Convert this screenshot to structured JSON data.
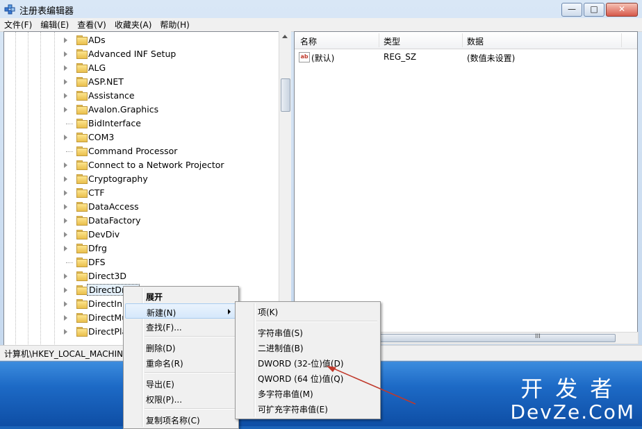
{
  "window": {
    "title": "注册表编辑器",
    "buttons": {
      "minimize": "—",
      "maximize": "□",
      "close": "✕"
    }
  },
  "menubar": [
    "文件(F)",
    "编辑(E)",
    "查看(V)",
    "收藏夹(A)",
    "帮助(H)"
  ],
  "tree": {
    "items": [
      {
        "label": "ADs",
        "expandable": true
      },
      {
        "label": "Advanced INF Setup",
        "expandable": true
      },
      {
        "label": "ALG",
        "expandable": true
      },
      {
        "label": "ASP.NET",
        "expandable": true
      },
      {
        "label": "Assistance",
        "expandable": true
      },
      {
        "label": "Avalon.Graphics",
        "expandable": true
      },
      {
        "label": "BidInterface",
        "expandable": false
      },
      {
        "label": "COM3",
        "expandable": true
      },
      {
        "label": "Command Processor",
        "expandable": false
      },
      {
        "label": "Connect to a Network Projector",
        "expandable": true
      },
      {
        "label": "Cryptography",
        "expandable": true
      },
      {
        "label": "CTF",
        "expandable": true
      },
      {
        "label": "DataAccess",
        "expandable": true
      },
      {
        "label": "DataFactory",
        "expandable": true
      },
      {
        "label": "DevDiv",
        "expandable": true
      },
      {
        "label": "Dfrg",
        "expandable": true
      },
      {
        "label": "DFS",
        "expandable": false
      },
      {
        "label": "Direct3D",
        "expandable": true
      },
      {
        "label": "DirectDraw",
        "expandable": true,
        "selected": true
      },
      {
        "label": "DirectInput",
        "expandable": true
      },
      {
        "label": "DirectMusic",
        "expandable": true
      },
      {
        "label": "DirectPlay",
        "expandable": true
      }
    ]
  },
  "list": {
    "columns": [
      "名称",
      "类型",
      "数据"
    ],
    "rows": [
      {
        "name": "(默认)",
        "type": "REG_SZ",
        "data": "(数值未设置)",
        "icon": "string-value-icon"
      }
    ]
  },
  "statusbar": {
    "path": "计算机\\HKEY_LOCAL_MACHIN"
  },
  "context_menu": {
    "items": [
      {
        "label": "展开",
        "bold": true
      },
      {
        "label": "新建(N)",
        "submenu": true,
        "highlight": true
      },
      {
        "label": "查找(F)..."
      },
      {
        "sep": true
      },
      {
        "label": "删除(D)"
      },
      {
        "label": "重命名(R)"
      },
      {
        "sep": true
      },
      {
        "label": "导出(E)"
      },
      {
        "label": "权限(P)..."
      },
      {
        "sep": true
      },
      {
        "label": "复制项名称(C)"
      }
    ]
  },
  "submenu": {
    "items": [
      {
        "label": "项(K)"
      },
      {
        "sep": true
      },
      {
        "label": "字符串值(S)"
      },
      {
        "label": "二进制值(B)"
      },
      {
        "label": "DWORD (32-位)值(D)"
      },
      {
        "label": "QWORD (64 位)值(Q)"
      },
      {
        "label": "多字符串值(M)"
      },
      {
        "label": "可扩充字符串值(E)"
      }
    ]
  },
  "watermark": {
    "cn": "开发者",
    "en": "DevZe.CoM"
  },
  "colors": {
    "annotation_arrow": "#c0392b",
    "desktop": "#1d6ac6",
    "selection": "#e5f1fb"
  }
}
